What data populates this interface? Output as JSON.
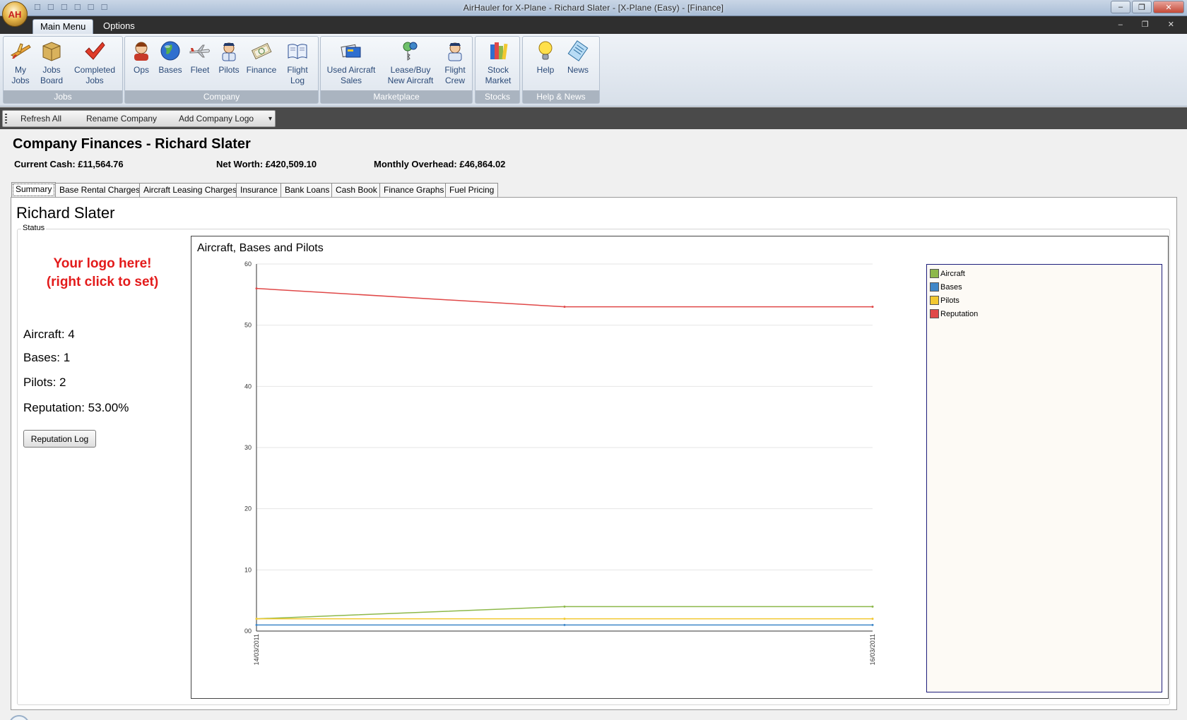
{
  "window": {
    "title": "AirHauler for X-Plane - Richard Slater - [X-Plane (Easy) - [Finance]",
    "orb_letters": "AH",
    "quick_access": "☐ ☐ ☐ ☐ ☐ ☐",
    "min": "–",
    "restore": "❐",
    "close": "✕",
    "mdi_controls": "– ❐ ✕"
  },
  "ribbon_tabs": [
    "Main Menu",
    "Options"
  ],
  "ribbon": {
    "groups": [
      {
        "label": "Jobs",
        "buttons": [
          {
            "label": "My Jobs",
            "lines": [
              "My",
              "Jobs"
            ],
            "icon": "plane-jobs-icon"
          },
          {
            "label": "Jobs Board",
            "lines": [
              "Jobs",
              "Board"
            ],
            "icon": "box-icon"
          },
          {
            "label": "Completed Jobs",
            "lines": [
              "Completed",
              "Jobs"
            ],
            "icon": "checkmark-icon"
          }
        ]
      },
      {
        "label": "Company",
        "buttons": [
          {
            "label": "Ops",
            "lines": [
              "Ops"
            ],
            "icon": "operator-icon"
          },
          {
            "label": "Bases",
            "lines": [
              "Bases"
            ],
            "icon": "globe-icon"
          },
          {
            "label": "Fleet",
            "lines": [
              "Fleet"
            ],
            "icon": "airplane-icon"
          },
          {
            "label": "Pilots",
            "lines": [
              "Pilots"
            ],
            "icon": "pilot-icon"
          },
          {
            "label": "Finance",
            "lines": [
              "Finance"
            ],
            "icon": "money-icon"
          },
          {
            "label": "Flight Log",
            "lines": [
              "Flight",
              "Log"
            ],
            "icon": "book-icon"
          }
        ]
      },
      {
        "label": "Marketplace",
        "buttons": [
          {
            "label": "Used Aircraft Sales",
            "lines": [
              "Used Aircraft",
              "Sales"
            ],
            "icon": "cards-icon"
          },
          {
            "label": "Lease/Buy New Aircraft",
            "lines": [
              "Lease/Buy",
              "New Aircraft"
            ],
            "icon": "keys-icon"
          },
          {
            "label": "Flight Crew",
            "lines": [
              "Flight",
              "Crew"
            ],
            "icon": "crew-icon"
          }
        ]
      },
      {
        "label": "Stocks",
        "buttons": [
          {
            "label": "Stock Market",
            "lines": [
              "Stock",
              "Market"
            ],
            "icon": "books-icon"
          }
        ]
      },
      {
        "label": "Help & News",
        "buttons": [
          {
            "label": "Help",
            "lines": [
              "Help"
            ],
            "icon": "lightbulb-icon"
          },
          {
            "label": "News",
            "lines": [
              "News"
            ],
            "icon": "news-icon"
          }
        ]
      }
    ]
  },
  "toolbar": {
    "refresh": "Refresh All",
    "rename": "Rename Company",
    "add_logo": "Add Company Logo",
    "overflow": "▾"
  },
  "page": {
    "title": "Company Finances - Richard Slater",
    "current_cash": "Current Cash: £11,564.76",
    "net_worth": "Net Worth: £420,509.10",
    "monthly_overhead": "Monthly Overhead: £46,864.02"
  },
  "tabs": [
    "Summary",
    "Base Rental Charges",
    "Aircraft Leasing Charges",
    "Insurance",
    "Bank Loans",
    "Cash Book",
    "Finance Graphs",
    "Fuel Pricing"
  ],
  "summary": {
    "owner": "Richard Slater",
    "status_label": "Status",
    "logo_line1": "Your logo here!",
    "logo_line2": "(right click to set)",
    "aircraft": "Aircraft: 4",
    "bases": "Bases: 1",
    "pilots": "Pilots: 2",
    "reputation": "Reputation: 53.00%",
    "reputation_button": "Reputation Log"
  },
  "colors": {
    "aircraft": "#8db84a",
    "bases": "#3f87c8",
    "pilots": "#f2c830",
    "reputation": "#e04848",
    "logo_red": "#e31b1b"
  },
  "chart_data": {
    "type": "line",
    "title": "Aircraft, Bases and Pilots",
    "x": [
      "14/03/2011",
      "15/03/2011",
      "16/03/2011"
    ],
    "x_tick_labels": [
      "14/03/2011",
      "16/03/2011"
    ],
    "ylim": [
      0,
      60
    ],
    "y_ticks": [
      "00",
      "10",
      "20",
      "30",
      "40",
      "50",
      "60"
    ],
    "grid": true,
    "legend_position": "right",
    "series": [
      {
        "name": "Aircraft",
        "values": [
          2,
          4,
          4
        ],
        "color": "#8db84a"
      },
      {
        "name": "Bases",
        "values": [
          1,
          1,
          1
        ],
        "color": "#3f87c8"
      },
      {
        "name": "Pilots",
        "values": [
          2,
          2,
          2
        ],
        "color": "#f2c830"
      },
      {
        "name": "Reputation",
        "values": [
          56,
          53,
          53
        ],
        "color": "#e04848"
      }
    ]
  }
}
